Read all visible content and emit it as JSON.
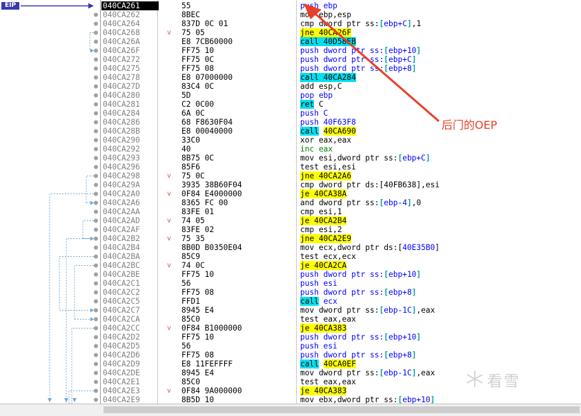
{
  "eip_label": "EIP",
  "annotation": "后门的OEP",
  "watermark": "看雪",
  "rows": [
    {
      "addr": "040CA261",
      "branch": "",
      "bytes": "55",
      "instr": [
        {
          "t": "push",
          "c": "kw-push"
        },
        {
          "t": " ebp",
          "c": "op-blue"
        }
      ]
    },
    {
      "addr": "040CA262",
      "branch": "",
      "bytes": "8BEC",
      "instr": [
        {
          "t": "mov",
          "c": "kw-plain"
        },
        {
          "t": " ebp,esp",
          "c": "kw-plain"
        }
      ]
    },
    {
      "addr": "040CA264",
      "branch": "",
      "bytes": "837D 0C 01",
      "instr": [
        {
          "t": "cmp dword ptr ss:",
          "c": "kw-plain"
        },
        {
          "t": "[",
          "c": "brk"
        },
        {
          "t": "ebp+C",
          "c": "op-blue"
        },
        {
          "t": "]",
          "c": "brk"
        },
        {
          "t": ",1",
          "c": "kw-plain"
        }
      ]
    },
    {
      "addr": "040CA268",
      "branch": "v",
      "bytes": "75 05",
      "instr": [
        {
          "t": "jne 40CA26F",
          "c": "hl-jmp"
        }
      ]
    },
    {
      "addr": "040CA26A",
      "branch": "",
      "bytes": "E8 7CB60000",
      "instr": [
        {
          "t": "call 40D58EB",
          "c": "hl-call"
        }
      ]
    },
    {
      "addr": "040CA26F",
      "branch": "",
      "bytes": "FF75 10",
      "instr": [
        {
          "t": "push dword ptr ss:",
          "c": "kw-push"
        },
        {
          "t": "[",
          "c": "brk"
        },
        {
          "t": "ebp+10",
          "c": "op-blue"
        },
        {
          "t": "]",
          "c": "brk"
        }
      ]
    },
    {
      "addr": "040CA272",
      "branch": "",
      "bytes": "FF75 0C",
      "instr": [
        {
          "t": "push dword ptr ss:",
          "c": "kw-push"
        },
        {
          "t": "[",
          "c": "brk"
        },
        {
          "t": "ebp+C",
          "c": "op-blue"
        },
        {
          "t": "]",
          "c": "brk"
        }
      ]
    },
    {
      "addr": "040CA275",
      "branch": "",
      "bytes": "FF75 08",
      "instr": [
        {
          "t": "push dword ptr ss:",
          "c": "kw-push"
        },
        {
          "t": "[",
          "c": "brk"
        },
        {
          "t": "ebp+8",
          "c": "op-blue"
        },
        {
          "t": "]",
          "c": "brk"
        }
      ]
    },
    {
      "addr": "040CA278",
      "branch": "",
      "bytes": "E8 07000000",
      "instr": [
        {
          "t": "call 40CA284",
          "c": "hl-call"
        }
      ]
    },
    {
      "addr": "040CA27D",
      "branch": "",
      "bytes": "83C4 0C",
      "instr": [
        {
          "t": "add esp,C",
          "c": "kw-plain"
        }
      ]
    },
    {
      "addr": "040CA280",
      "branch": "",
      "bytes": "5D",
      "instr": [
        {
          "t": "pop ebp",
          "c": "kw-push"
        }
      ]
    },
    {
      "addr": "040CA281",
      "branch": "",
      "bytes": "C2 0C00",
      "instr": [
        {
          "t": "ret",
          "c": "hl-ret"
        },
        {
          "t": " C",
          "c": "kw-plain"
        }
      ]
    },
    {
      "addr": "040CA284",
      "branch": "",
      "bytes": "6A 0C",
      "instr": [
        {
          "t": "push C",
          "c": "kw-push"
        }
      ]
    },
    {
      "addr": "040CA286",
      "branch": "",
      "bytes": "68 F8630F04",
      "instr": [
        {
          "t": "push 40F63F8",
          "c": "kw-push"
        }
      ]
    },
    {
      "addr": "040CA28B",
      "branch": "",
      "bytes": "E8 00040000",
      "instr": [
        {
          "t": "call",
          "c": "hl-call"
        },
        {
          "t": " ",
          "c": "kw-plain"
        },
        {
          "t": "40CA690",
          "c": "hl-jmp"
        }
      ]
    },
    {
      "addr": "040CA290",
      "branch": "",
      "bytes": "33C0",
      "instr": [
        {
          "t": "xor eax,eax",
          "c": "kw-plain"
        }
      ]
    },
    {
      "addr": "040CA292",
      "branch": "",
      "bytes": "40",
      "instr": [
        {
          "t": "inc eax",
          "c": "op-green"
        }
      ]
    },
    {
      "addr": "040CA293",
      "branch": "",
      "bytes": "8B75 0C",
      "instr": [
        {
          "t": "mov esi,dword ptr ss:",
          "c": "kw-plain"
        },
        {
          "t": "[",
          "c": "brk"
        },
        {
          "t": "ebp+C",
          "c": "op-blue"
        },
        {
          "t": "]",
          "c": "brk"
        }
      ]
    },
    {
      "addr": "040CA296",
      "branch": "",
      "bytes": "85F6",
      "instr": [
        {
          "t": "test esi,esi",
          "c": "kw-plain"
        }
      ]
    },
    {
      "addr": "040CA298",
      "branch": "v",
      "bytes": "75 0C",
      "instr": [
        {
          "t": "jne 40CA2A6",
          "c": "hl-jmp"
        }
      ]
    },
    {
      "addr": "040CA29A",
      "branch": "",
      "bytes": "3935 38B60F04",
      "instr": [
        {
          "t": "cmp dword ptr ds:[40FB638],esi",
          "c": "kw-plain"
        }
      ]
    },
    {
      "addr": "040CA2A0",
      "branch": "v",
      "bytes": "0F84 E4000000",
      "instr": [
        {
          "t": "je 40CA38A",
          "c": "hl-jmp"
        }
      ]
    },
    {
      "addr": "040CA2A6",
      "branch": "",
      "bytes": "8365 FC 00",
      "instr": [
        {
          "t": "and dword ptr ss:",
          "c": "kw-plain"
        },
        {
          "t": "[",
          "c": "brk"
        },
        {
          "t": "ebp-4",
          "c": "op-blue"
        },
        {
          "t": "]",
          "c": "brk"
        },
        {
          "t": ",0",
          "c": "kw-plain"
        }
      ]
    },
    {
      "addr": "040CA2AA",
      "branch": "",
      "bytes": "83FE 01",
      "instr": [
        {
          "t": "cmp esi,1",
          "c": "kw-plain"
        }
      ]
    },
    {
      "addr": "040CA2AD",
      "branch": "v",
      "bytes": "74 05",
      "instr": [
        {
          "t": "je 40CA2B4",
          "c": "hl-jmp"
        }
      ]
    },
    {
      "addr": "040CA2AF",
      "branch": "",
      "bytes": "83FE 02",
      "instr": [
        {
          "t": "cmp esi,2",
          "c": "kw-plain"
        }
      ]
    },
    {
      "addr": "040CA2B2",
      "branch": "v",
      "bytes": "75 35",
      "instr": [
        {
          "t": "jne 40CA2E9",
          "c": "hl-jmp"
        }
      ]
    },
    {
      "addr": "040CA2B4",
      "branch": "",
      "bytes": "8B0D B0350E04",
      "instr": [
        {
          "t": "mov ecx,dword ptr ds:[",
          "c": "kw-plain"
        },
        {
          "t": "40E35B0",
          "c": "op-blue"
        },
        {
          "t": "]",
          "c": "kw-plain"
        }
      ]
    },
    {
      "addr": "040CA2BA",
      "branch": "",
      "bytes": "85C9",
      "instr": [
        {
          "t": "test ecx,ecx",
          "c": "kw-plain"
        }
      ]
    },
    {
      "addr": "040CA2BC",
      "branch": "v",
      "bytes": "74 0C",
      "instr": [
        {
          "t": "je 40CA2CA",
          "c": "hl-jmp"
        }
      ]
    },
    {
      "addr": "040CA2BE",
      "branch": "",
      "bytes": "FF75 10",
      "instr": [
        {
          "t": "push dword ptr ss:",
          "c": "kw-push"
        },
        {
          "t": "[",
          "c": "brk"
        },
        {
          "t": "ebp+10",
          "c": "op-blue"
        },
        {
          "t": "]",
          "c": "brk"
        }
      ]
    },
    {
      "addr": "040CA2C1",
      "branch": "",
      "bytes": "56",
      "instr": [
        {
          "t": "push esi",
          "c": "kw-push"
        }
      ]
    },
    {
      "addr": "040CA2C2",
      "branch": "",
      "bytes": "FF75 08",
      "instr": [
        {
          "t": "push dword ptr ss:",
          "c": "kw-push"
        },
        {
          "t": "[",
          "c": "brk"
        },
        {
          "t": "ebp+8",
          "c": "op-blue"
        },
        {
          "t": "]",
          "c": "brk"
        }
      ]
    },
    {
      "addr": "040CA2C5",
      "branch": "",
      "bytes": "FFD1",
      "instr": [
        {
          "t": "call",
          "c": "hl-call"
        },
        {
          "t": " ecx",
          "c": "op-blue"
        }
      ]
    },
    {
      "addr": "040CA2C7",
      "branch": "",
      "bytes": "8945 E4",
      "instr": [
        {
          "t": "mov dword ptr ss:",
          "c": "kw-plain"
        },
        {
          "t": "[",
          "c": "brk"
        },
        {
          "t": "ebp-1C",
          "c": "op-blue"
        },
        {
          "t": "]",
          "c": "brk"
        },
        {
          "t": ",eax",
          "c": "kw-plain"
        }
      ]
    },
    {
      "addr": "040CA2CA",
      "branch": "",
      "bytes": "85C0",
      "instr": [
        {
          "t": "test eax,eax",
          "c": "kw-plain"
        }
      ]
    },
    {
      "addr": "040CA2CC",
      "branch": "v",
      "bytes": "0F84 B1000000",
      "instr": [
        {
          "t": "je 40CA383",
          "c": "hl-jmp"
        }
      ]
    },
    {
      "addr": "040CA2D2",
      "branch": "",
      "bytes": "FF75 10",
      "instr": [
        {
          "t": "push dword ptr ss:",
          "c": "kw-push"
        },
        {
          "t": "[",
          "c": "brk"
        },
        {
          "t": "ebp+10",
          "c": "op-blue"
        },
        {
          "t": "]",
          "c": "brk"
        }
      ]
    },
    {
      "addr": "040CA2D5",
      "branch": "",
      "bytes": "56",
      "instr": [
        {
          "t": "push esi",
          "c": "kw-push"
        }
      ]
    },
    {
      "addr": "040CA2D6",
      "branch": "",
      "bytes": "FF75 08",
      "instr": [
        {
          "t": "push dword ptr ss:",
          "c": "kw-push"
        },
        {
          "t": "[",
          "c": "brk"
        },
        {
          "t": "ebp+8",
          "c": "op-blue"
        },
        {
          "t": "]",
          "c": "brk"
        }
      ]
    },
    {
      "addr": "040CA2D9",
      "branch": "",
      "bytes": "E8 11FEFFFF",
      "instr": [
        {
          "t": "call",
          "c": "hl-call"
        },
        {
          "t": " ",
          "c": "kw-plain"
        },
        {
          "t": "40CA0EF",
          "c": "hl-jmp"
        }
      ]
    },
    {
      "addr": "040CA2DE",
      "branch": "",
      "bytes": "8945 E4",
      "instr": [
        {
          "t": "mov dword ptr ss:",
          "c": "kw-plain"
        },
        {
          "t": "[",
          "c": "brk"
        },
        {
          "t": "ebp-1C",
          "c": "op-blue"
        },
        {
          "t": "]",
          "c": "brk"
        },
        {
          "t": ",eax",
          "c": "kw-plain"
        }
      ]
    },
    {
      "addr": "040CA2E1",
      "branch": "",
      "bytes": "85C0",
      "instr": [
        {
          "t": "test eax,eax",
          "c": "kw-plain"
        }
      ]
    },
    {
      "addr": "040CA2E3",
      "branch": "v",
      "bytes": "0F84 9A000000",
      "instr": [
        {
          "t": "je 40CA383",
          "c": "hl-jmp"
        }
      ]
    },
    {
      "addr": "040CA2E9",
      "branch": "",
      "bytes": "8B5D 10",
      "instr": [
        {
          "t": "mov ebx,dword ptr ss:",
          "c": "kw-plain"
        },
        {
          "t": "[",
          "c": "brk"
        },
        {
          "t": "ebp+10",
          "c": "op-blue"
        },
        {
          "t": "]",
          "c": "brk"
        }
      ]
    }
  ]
}
